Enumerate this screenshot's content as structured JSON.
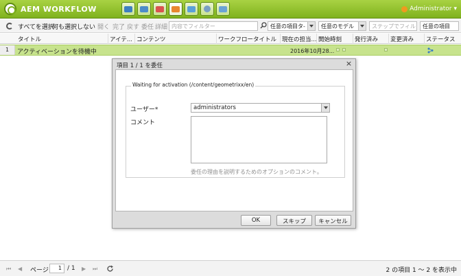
{
  "header": {
    "app_title": "AEM WORKFLOW",
    "user": "Administrator",
    "nav_icons": [
      "models-icon",
      "instances-icon",
      "launchers-icon",
      "inbox-icon",
      "archive-icon",
      "failures-icon",
      "tag-icon"
    ]
  },
  "toolbar": {
    "select_all": "すべてを選択",
    "select_none": "何も選択しない",
    "open": "開く",
    "complete": "完了",
    "step_back": "戻す",
    "delegate": "委任",
    "details": "詳細",
    "filter_placeholder": "内容でフィルター",
    "item_type": "任意の項目タ-",
    "model": "任意のモデル",
    "step_filter": "ステップでフィル",
    "any_item": "任意の項目"
  },
  "table": {
    "columns": [
      "タイトル",
      "アイテ...",
      "コンテンツ",
      "ワークフロータイトル",
      "現在の担当...",
      "開始時刻",
      "発行済み",
      "変更済み",
      "ステータス"
    ],
    "rows": [
      {
        "num": "1",
        "title": "アクティベーションを待機中",
        "date": "2016年10月28..."
      }
    ]
  },
  "dialog": {
    "title": "項目 1 / 1 を委任",
    "legend": "Waiting for activation (/content/geometrixx/en)",
    "user_label": "ユーザー*",
    "user_value": "administrators",
    "comment_label": "コメント",
    "hint": "委任の理由を説明するためのオプションのコメント。",
    "ok": "OK",
    "skip": "スキップ",
    "cancel": "キャンセル"
  },
  "pager": {
    "page_label": "ページ",
    "page_value": "1",
    "total_pages": "/ 1",
    "info": "2 の項目 1 ～ 2 を表示中"
  }
}
